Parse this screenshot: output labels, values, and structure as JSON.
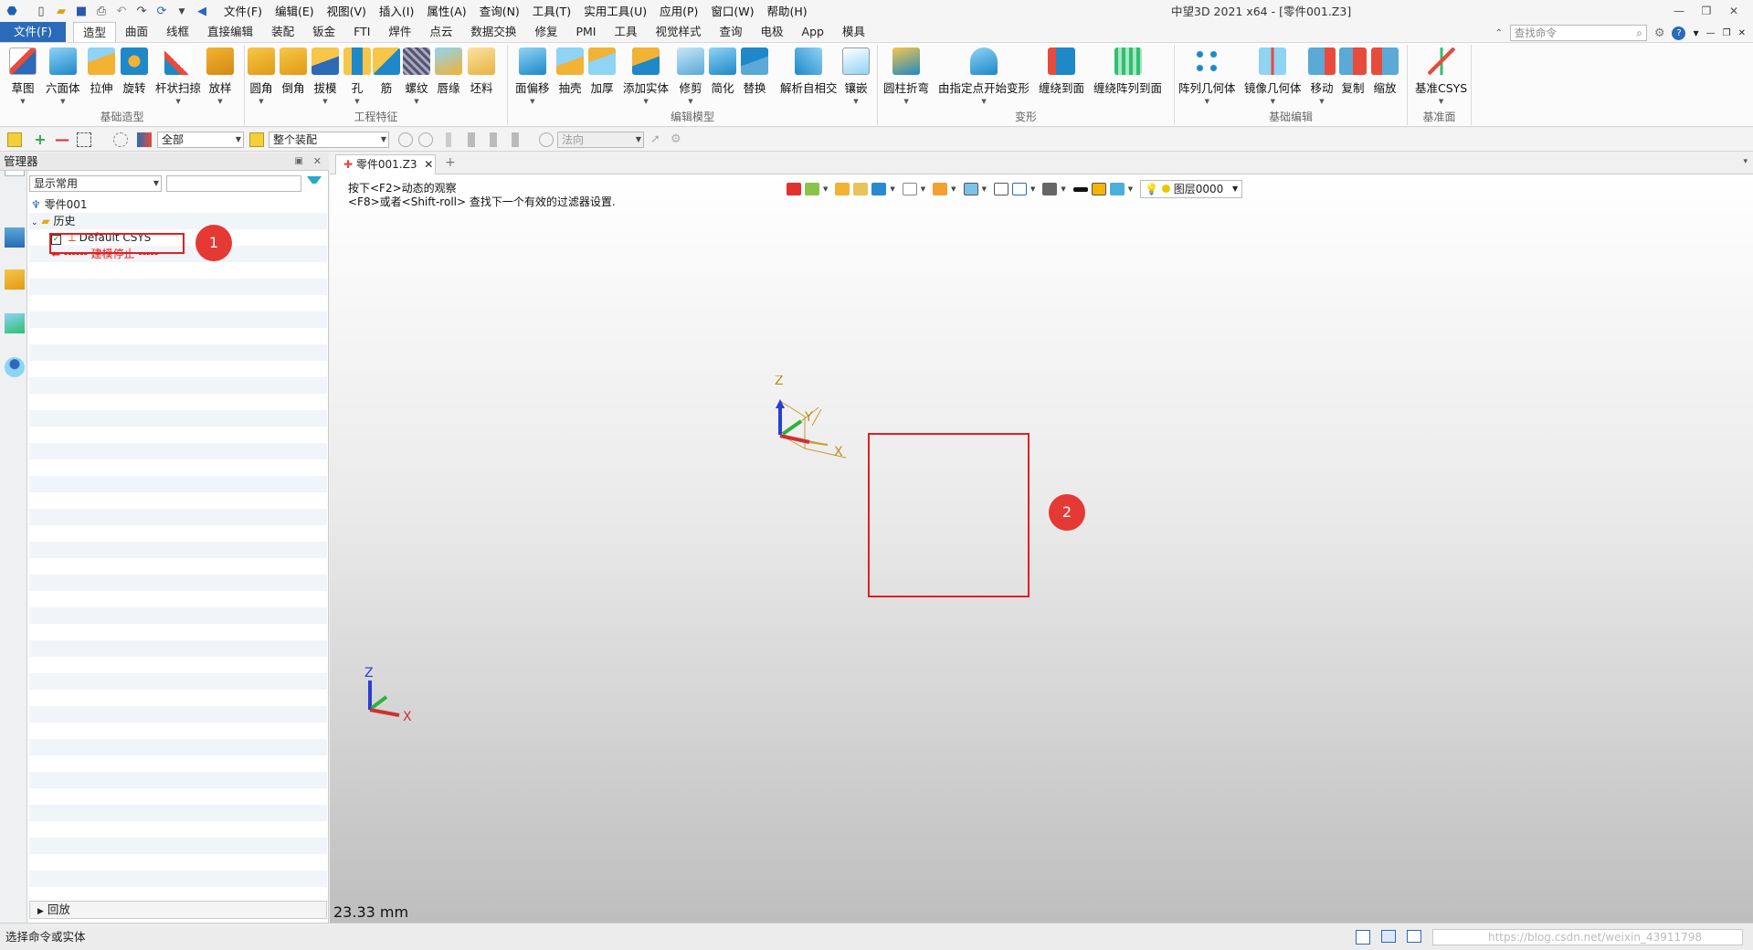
{
  "window": {
    "title": "中望3D 2021 x64 - [零件001.Z3]"
  },
  "menu": [
    "文件(F)",
    "编辑(E)",
    "视图(V)",
    "插入(I)",
    "属性(A)",
    "查询(N)",
    "工具(T)",
    "实用工具(U)",
    "应用(P)",
    "窗口(W)",
    "帮助(H)"
  ],
  "ribbon_tabs": [
    "文件(F)",
    "造型",
    "曲面",
    "线框",
    "直接编辑",
    "装配",
    "钣金",
    "FTI",
    "焊件",
    "点云",
    "数据交换",
    "修复",
    "PMI",
    "工具",
    "视觉样式",
    "查询",
    "电极",
    "App",
    "模具"
  ],
  "active_tab": "造型",
  "command_search": {
    "placeholder": "查找命令"
  },
  "ribbon_groups": [
    {
      "label": "基础造型",
      "buttons": [
        "草图",
        "六面体",
        "拉伸",
        "旋转",
        "杆状扫掠",
        "放样"
      ]
    },
    {
      "label": "工程特征",
      "buttons": [
        "圆角",
        "倒角",
        "拔模",
        "孔",
        "筋",
        "螺纹",
        "唇缘",
        "坯料"
      ]
    },
    {
      "label": "编辑模型",
      "buttons": [
        "面偏移",
        "抽壳",
        "加厚",
        "添加实体",
        "修剪",
        "简化",
        "替换",
        "解析自相交",
        "镶嵌"
      ]
    },
    {
      "label": "变形",
      "buttons": [
        "圆柱折弯",
        "由指定点开始变形",
        "缠绕到面",
        "缠绕阵列到面"
      ]
    },
    {
      "label": "基础编辑",
      "buttons": [
        "阵列几何体",
        "镜像几何体",
        "移动",
        "复制",
        "缩放"
      ]
    },
    {
      "label": "基准面",
      "buttons": [
        "基准CSYS"
      ]
    }
  ],
  "toolbar2": {
    "filter_value": "全部",
    "assembly_value": "整个装配",
    "direction_value": "法向"
  },
  "manager": {
    "title": "管理器",
    "display_filter": "显示常用",
    "search_value": "",
    "root": "零件001",
    "history_label": "历史",
    "csys_label": "Default CSYS",
    "stop_label": "------ 建模停止 -----",
    "playback_label": "回放"
  },
  "document": {
    "tab_label": "零件001.Z3",
    "hint_line1": "按下<F2>动态的观察",
    "hint_line2": "<F8>或者<Shift-roll> 查找下一个有效的过滤器设置.",
    "layer": "图层0000",
    "scale": "23.33 mm",
    "axes": {
      "x": "X",
      "y": "Y",
      "z": "Z"
    }
  },
  "callouts": [
    "1",
    "2"
  ],
  "status": {
    "prompt": "选择命令或实体",
    "watermark": "https://blog.csdn.net/weixin_43911798"
  }
}
